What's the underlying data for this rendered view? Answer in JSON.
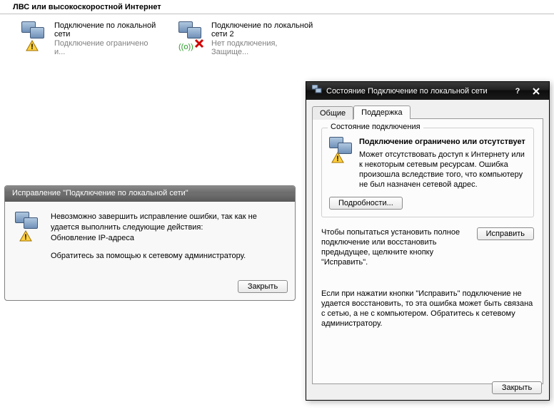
{
  "section": {
    "title": "ЛВС или высокоскоростной Интернет"
  },
  "connections": [
    {
      "name": "Подключение по локальной сети",
      "status": "Подключение ограничено и...",
      "overlay": "warning"
    },
    {
      "name": "Подключение по локальной сети 2",
      "status": "Нет подключения, Защище...",
      "overlay": "error"
    }
  ],
  "repair_dialog": {
    "title": "Исправление \"Подключение по локальной сети\"",
    "line1": "Невозможно завершить исправление ошибки, так как не удается выполнить следующие действия:",
    "line2": "Обновление IP-адреса",
    "line3": "Обратитесь за помощью к сетевому администратору.",
    "close_btn": "Закрыть"
  },
  "status_dialog": {
    "title": "Состояние Подключение по локальной сети",
    "tabs": [
      {
        "label": "Общие"
      },
      {
        "label": "Поддержка"
      }
    ],
    "group_title": "Состояние подключения",
    "status_bold": "Подключение ограничено или отсутствует",
    "status_desc": "Может отсутствовать доступ к Интернету или к некоторым сетевым ресурсам. Ошибка произошла вследствие того, что компьютеру не был назначен сетевой адрес.",
    "details_btn": "Подробности...",
    "repair_hint": "Чтобы попытаться установить полное подключение или восстановить предыдущее, щелкните кнопку \"Исправить\".",
    "repair_btn": "Исправить",
    "note": "Если при нажатии кнопки \"Исправить\" подключение не удается восстановить, то эта ошибка может быть связана с сетью, а не с компьютером.  Обратитесь к сетевому администратору.",
    "close_btn": "Закрыть"
  }
}
